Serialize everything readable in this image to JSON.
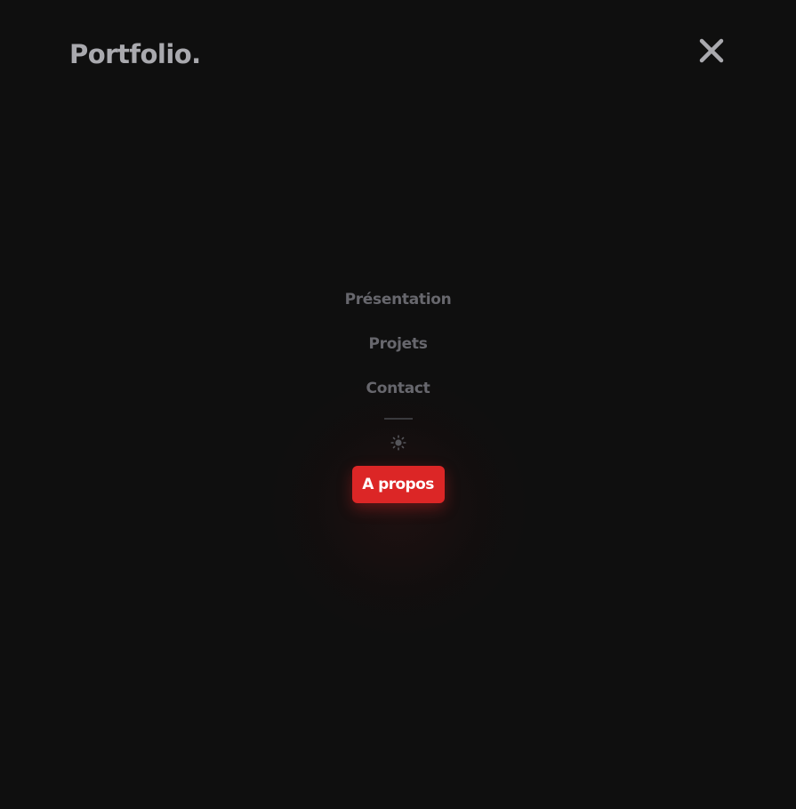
{
  "header": {
    "logo_text": "Portfolio.",
    "close_icon": "close-icon"
  },
  "nav": {
    "items": [
      {
        "label": "Présentation"
      },
      {
        "label": "Projets"
      },
      {
        "label": "Contact"
      }
    ],
    "theme_icon": "sun-icon",
    "cta_label": "A propos"
  },
  "colors": {
    "background": "#0f0f0f",
    "logo": "#a9a9ae",
    "nav_text": "#67676d",
    "accent": "#dc2626"
  }
}
